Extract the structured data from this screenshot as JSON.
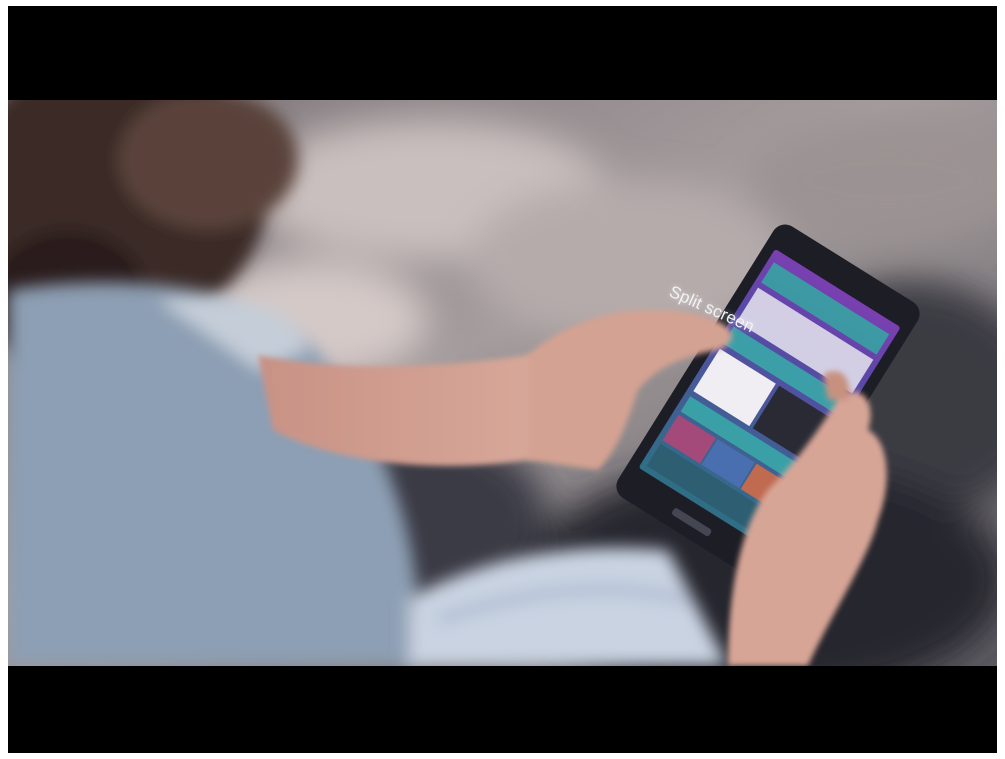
{
  "video": {
    "caption": "Split screen"
  },
  "scene": {
    "description_icon": "person-holding-smartphone",
    "colors": {
      "letterbox": "#000000",
      "background_blur": "#8a8488",
      "shirt": "#9aaabb",
      "skin": "#d7a596",
      "phone_body": "#1c1d25",
      "screen_purple": "#6c3fa0",
      "screen_teal": "#3aa7a8"
    }
  }
}
